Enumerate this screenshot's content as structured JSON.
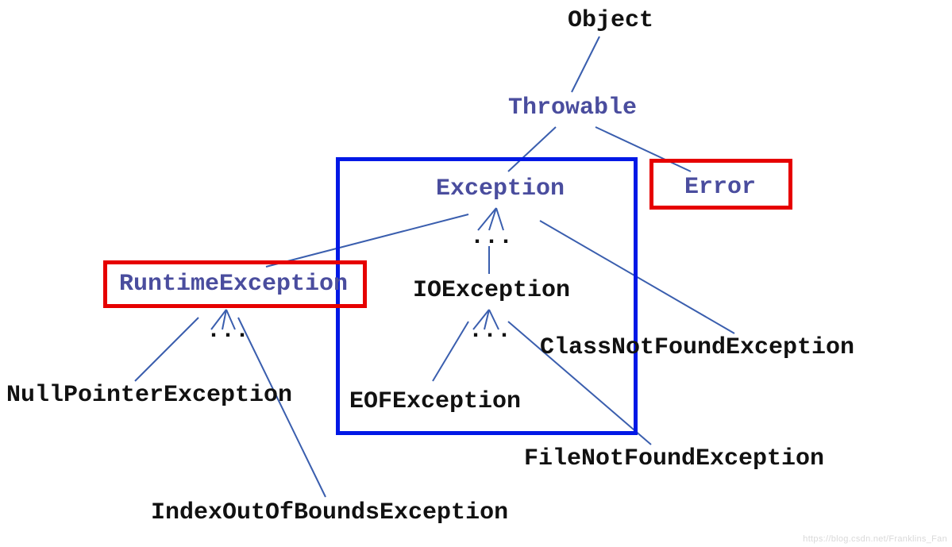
{
  "nodes": {
    "object": "Object",
    "throwable": "Throwable",
    "exception": "Exception",
    "error": "Error",
    "runtime_exception": "RuntimeException",
    "io_exception": "IOException",
    "class_not_found": "ClassNotFoundException",
    "null_pointer": "NullPointerException",
    "eof_exception": "EOFException",
    "file_not_found": "FileNotFoundException",
    "index_oob": "IndexOutOfBoundsException"
  },
  "dots": {
    "under_exception": "...",
    "under_runtime": "...",
    "under_ioexception": "..."
  },
  "colors": {
    "purple": "#4a4d9e",
    "black": "#111111",
    "blue_box": "#0018e6",
    "red_box": "#e60000",
    "line": "#3a5eae"
  },
  "watermark": "https://blog.csdn.net/Franklins_Fan",
  "hierarchy": {
    "Object": {
      "Throwable": {
        "Exception": {
          "RuntimeException": [
            "NullPointerException",
            "IndexOutOfBoundsException",
            "..."
          ],
          "IOException": [
            "EOFException",
            "FileNotFoundException",
            "..."
          ],
          "ClassNotFoundException": [],
          "...": []
        },
        "Error": {}
      }
    }
  },
  "highlights": {
    "blue_box_around": [
      "Exception",
      "IOException",
      "EOFException"
    ],
    "red_box_around": [
      "RuntimeException",
      "Error"
    ]
  }
}
